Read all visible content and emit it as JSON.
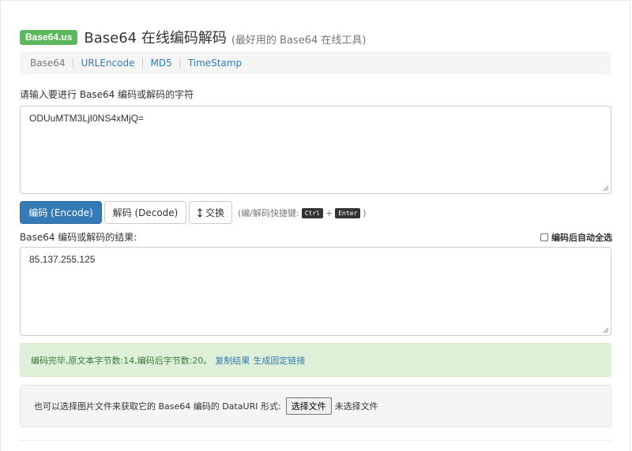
{
  "header": {
    "badge": "Base64.us",
    "title": "Base64 在线编码解码",
    "subtitle": "(最好用的 Base64 在线工具)"
  },
  "nav": {
    "items": [
      {
        "label": "Base64",
        "active": true
      },
      {
        "label": "URLEncode",
        "active": false
      },
      {
        "label": "MD5",
        "active": false
      },
      {
        "label": "TimeStamp",
        "active": false
      }
    ],
    "separator": "|"
  },
  "input": {
    "label": "请输入要进行 Base64 编码或解码的字符",
    "value": "ODUuMTM3LjI0NS4xMjQ="
  },
  "actions": {
    "encode_label": "编码 (Encode)",
    "decode_label": "解码 (Decode)",
    "swap_label": "交换",
    "hint_prefix": "(编/解码快捷键:",
    "key_ctrl": "Ctrl",
    "plus": "+",
    "key_enter": "Enter",
    "hint_suffix": ")"
  },
  "output": {
    "label": "Base64 编码或解码的结果:",
    "auto_select_label": "编码后自动全选",
    "value": "85.137.255.125"
  },
  "status": {
    "message": "编码完毕,原文本字节数:14,编码后字节数:20。",
    "copy_link": "复制结果",
    "permalink": "生成固定链接"
  },
  "file": {
    "prompt": "也可以选择图片文件来获取它的 Base64 编码的 DataURI 形式:",
    "button": "选择文件",
    "no_file": "未选择文件"
  },
  "colors": {
    "primary": "#337ab7",
    "badge": "#5cb85c",
    "success_bg": "#dff0d8",
    "success_text": "#3c763d"
  }
}
